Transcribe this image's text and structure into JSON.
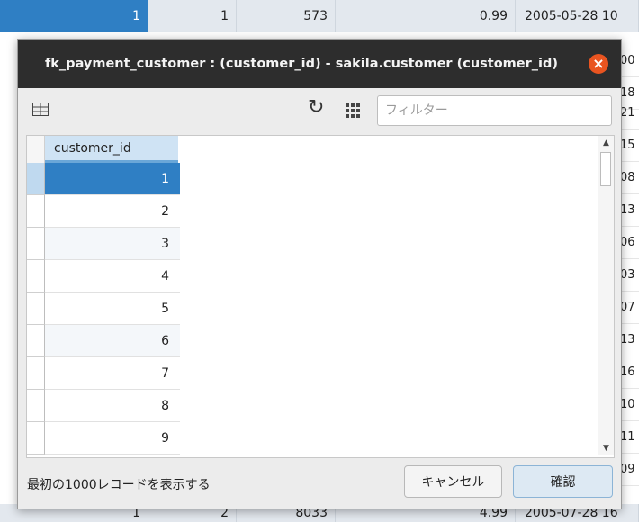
{
  "background_table": {
    "top_row": [
      "1",
      "1",
      "573",
      "0.99",
      "2005-05-28 10"
    ],
    "bottom_row": [
      "1",
      "2",
      "8033",
      "4.99",
      "2005-07-28 16"
    ],
    "right_fragments": [
      "00",
      "18",
      "21",
      "15",
      "08",
      "13",
      "06",
      "03",
      "07",
      "13",
      "16",
      "10",
      "11",
      "09"
    ]
  },
  "dialog": {
    "title": "fk_payment_customer : (customer_id) - sakila.customer (customer_id)",
    "toolbar": {
      "filter_placeholder": "フィルター"
    },
    "table": {
      "column_header": "customer_id",
      "rows": [
        "1",
        "2",
        "3",
        "4",
        "5",
        "6",
        "7",
        "8",
        "9"
      ],
      "selected_row": "1"
    },
    "footer": {
      "note": "最初の1000レコードを表示する",
      "cancel_label": "キャンセル",
      "ok_label": "確認"
    }
  },
  "colors": {
    "selection": "#2f7fc4",
    "titlebar": "#2d2d2d",
    "close": "#e95420"
  }
}
